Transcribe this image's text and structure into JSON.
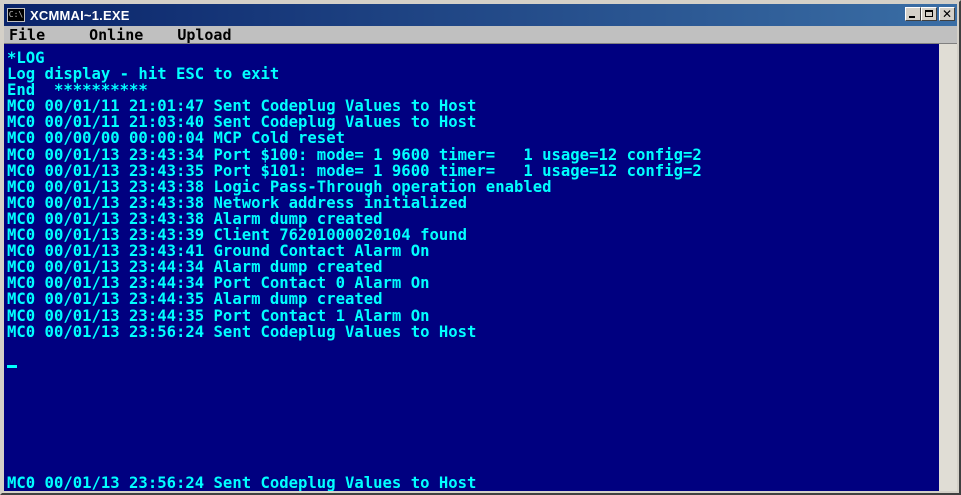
{
  "window": {
    "title": "XCMMAI~1.EXE",
    "icon": "console-icon",
    "icon_text": "C:\\",
    "caption_buttons": {
      "minimize": "minimize-icon",
      "maximize": "maximize-icon",
      "close": "close-icon"
    }
  },
  "menu": {
    "items": [
      {
        "label": "File"
      },
      {
        "label": "Online"
      },
      {
        "label": "Upload"
      }
    ]
  },
  "console": {
    "colors": {
      "background": "#000080",
      "text": "#00ffff"
    },
    "lines": [
      "*LOG",
      "Log display - hit ESC to exit",
      "End  **********",
      "MC0 00/01/11 21:01:47 Sent Codeplug Values to Host",
      "MC0 00/01/11 21:03:40 Sent Codeplug Values to Host",
      "MC0 00/00/00 00:00:04 MCP Cold reset",
      "MC0 00/01/13 23:43:34 Port $100: mode= 1 9600 timer=   1 usage=12 config=2",
      "MC0 00/01/13 23:43:35 Port $101: mode= 1 9600 timer=   1 usage=12 config=2",
      "MC0 00/01/13 23:43:38 Logic Pass-Through operation enabled",
      "MC0 00/01/13 23:43:38 Network address initialized",
      "MC0 00/01/13 23:43:38 Alarm dump created",
      "MC0 00/01/13 23:43:39 Client 76201000020104 found",
      "MC0 00/01/13 23:43:41 Ground Contact Alarm On",
      "MC0 00/01/13 23:44:34 Alarm dump created",
      "MC0 00/01/13 23:44:34 Port Contact 0 Alarm On",
      "MC0 00/01/13 23:44:35 Alarm dump created",
      "MC0 00/01/13 23:44:35 Port Contact 1 Alarm On",
      "MC0 00/01/13 23:56:24 Sent Codeplug Values to Host"
    ],
    "status_line": "MC0 00/01/13 23:56:24 Sent Codeplug Values to Host"
  }
}
